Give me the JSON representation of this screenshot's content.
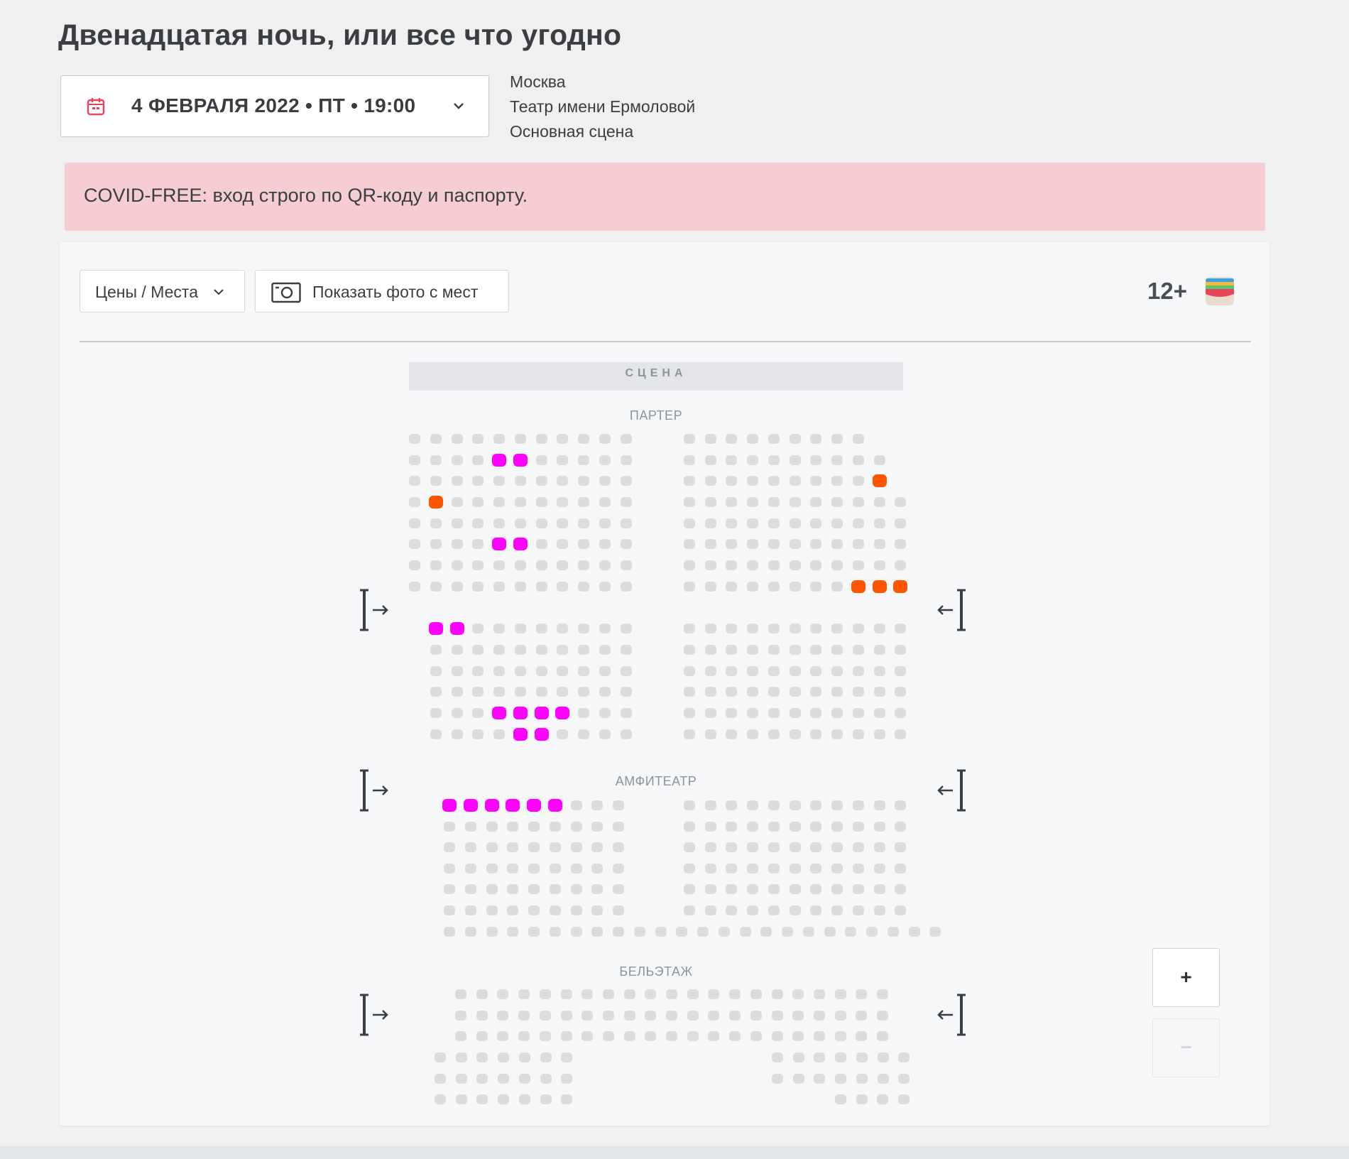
{
  "event": {
    "title": "Двенадцатая ночь, или все что угодно",
    "date_label": "4 ФЕВРАЛЯ 2022 • ПТ • 19:00",
    "city": "Москва",
    "theatre": "Театр имени Ермоловой",
    "hall": "Основная сцена"
  },
  "notice": "COVID-FREE: вход строго по QR-коду и паспорту.",
  "toolbar": {
    "prices_label": "Цены / Места",
    "photo_label": "Показать фото с мест",
    "age_rating": "12+"
  },
  "hall_map": {
    "stage_label": "СЦЕНА",
    "sections": [
      "ПАРТЕР",
      "АМФИТЕАТР",
      "БЕЛЬЭТАЖ"
    ],
    "available_seats": {
      "parter": [
        {
          "row": 2,
          "side": "left",
          "seats": [
            5,
            6
          ],
          "color": "#ff00ff"
        },
        {
          "row": 3,
          "side": "right",
          "seats": [
            10,
            11
          ],
          "color": "#ff5500"
        },
        {
          "row": 4,
          "side": "left",
          "seats": [
            2
          ],
          "color": "#ff5500"
        },
        {
          "row": 6,
          "side": "left",
          "seats": [
            5,
            6
          ],
          "color": "#ff00ff"
        },
        {
          "row": 8,
          "side": "right",
          "seats": [
            9,
            10,
            11,
            12
          ],
          "color": "#ff5500"
        },
        {
          "row": 9,
          "side": "left",
          "seats": [
            1,
            2
          ],
          "color": "#ff00ff"
        },
        {
          "row": 13,
          "side": "left",
          "seats": [
            4,
            5,
            6,
            7
          ],
          "color": "#ff00ff"
        },
        {
          "row": 14,
          "side": "left",
          "seats": [
            5,
            6
          ],
          "color": "#ff00ff"
        }
      ],
      "amphitheatre": [
        {
          "row": 1,
          "side": "left",
          "seats": [
            1,
            2,
            3,
            4,
            5,
            6
          ],
          "color": "#ff00ff"
        }
      ]
    }
  },
  "zoom": {
    "in_label": "+",
    "out_label": "−"
  },
  "colors": {
    "pink": "#ff00ff",
    "orange": "#ff5500",
    "unavailable": "#dcdcdc",
    "notice_bg": "#f6cdd2"
  }
}
